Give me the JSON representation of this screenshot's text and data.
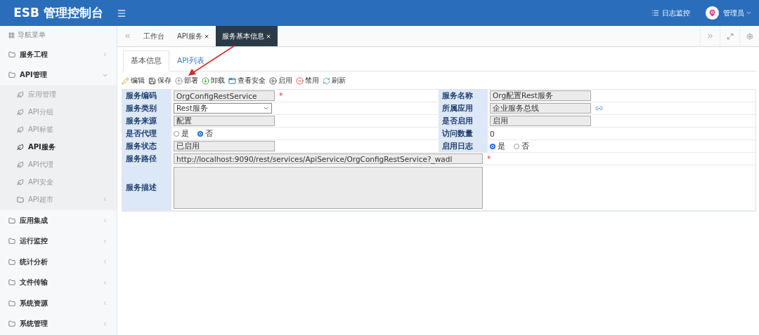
{
  "header": {
    "title": "ESB 管理控制台",
    "log_link": "日志监控",
    "user": "管理员"
  },
  "sidebar": {
    "title": "导航菜单",
    "items": [
      {
        "label": "服务工程",
        "kind": "folder",
        "expanded": false,
        "selected": false
      },
      {
        "label": "API管理",
        "kind": "folder",
        "expanded": true,
        "selected": false,
        "children": [
          {
            "label": "应用管理",
            "kind": "leaf",
            "selected": false
          },
          {
            "label": "API分组",
            "kind": "leaf",
            "selected": false
          },
          {
            "label": "API标签",
            "kind": "leaf",
            "selected": false
          },
          {
            "label": "API服务",
            "kind": "leaf",
            "selected": true
          },
          {
            "label": "API代理",
            "kind": "leaf",
            "selected": false
          },
          {
            "label": "API安全",
            "kind": "leaf",
            "selected": false
          },
          {
            "label": "API超市",
            "kind": "folder",
            "expanded": false,
            "selected": false
          }
        ]
      },
      {
        "label": "应用集成",
        "kind": "folder",
        "expanded": false,
        "selected": false
      },
      {
        "label": "运行监控",
        "kind": "folder",
        "expanded": false,
        "selected": false
      },
      {
        "label": "统计分析",
        "kind": "folder",
        "expanded": false,
        "selected": false
      },
      {
        "label": "文件传输",
        "kind": "folder",
        "expanded": false,
        "selected": false
      },
      {
        "label": "系统资源",
        "kind": "folder",
        "expanded": false,
        "selected": false
      },
      {
        "label": "系统管理",
        "kind": "folder",
        "expanded": false,
        "selected": false
      }
    ]
  },
  "tabs": [
    {
      "label": "工作台",
      "closable": false,
      "selected": false
    },
    {
      "label": "API服务",
      "closable": true,
      "selected": false
    },
    {
      "label": "服务基本信息",
      "closable": true,
      "selected": true
    }
  ],
  "subtabs": [
    {
      "label": "基本信息",
      "selected": true
    },
    {
      "label": "API列表",
      "selected": false
    }
  ],
  "toolbar": [
    "编辑",
    "保存",
    "部署",
    "卸载",
    "查看安全",
    "启用",
    "禁用",
    "刷新"
  ],
  "form": {
    "rows": [
      {
        "fields": [
          {
            "label": "服务编码",
            "kind": "input",
            "value": "OrgConfigRestService",
            "required_mark": "*"
          },
          {
            "label": "服务名称",
            "kind": "input",
            "value": "Org配置Rest服务"
          }
        ]
      },
      {
        "fields": [
          {
            "label": "服务类别",
            "kind": "select",
            "value": "Rest服务"
          },
          {
            "label": "所属应用",
            "kind": "lookup",
            "value": "企业服务总线"
          }
        ]
      },
      {
        "fields": [
          {
            "label": "服务来源",
            "kind": "input",
            "value": "配置"
          },
          {
            "label": "是否启用",
            "kind": "input",
            "value": "启用"
          }
        ]
      },
      {
        "fields": [
          {
            "label": "是否代理",
            "kind": "radio",
            "options": [
              {
                "label": "是",
                "selected": false
              },
              {
                "label": "否",
                "selected": true
              }
            ]
          },
          {
            "label": "访问数量",
            "kind": "text",
            "value": "0"
          }
        ]
      },
      {
        "fields": [
          {
            "label": "服务状态",
            "kind": "input",
            "value": "已启用"
          },
          {
            "label": "启用日志",
            "kind": "radio",
            "options": [
              {
                "label": "是",
                "selected": true
              },
              {
                "label": "否",
                "selected": false
              }
            ]
          }
        ]
      },
      {
        "fields": [
          {
            "label": "服务路径",
            "kind": "input",
            "value": "http://localhost:9090/rest/services/ApiService/OrgConfigRestService?_wadl",
            "required_mark": "*"
          }
        ]
      },
      {
        "fields": [
          {
            "label": "服务描述",
            "kind": "textarea"
          }
        ]
      }
    ]
  }
}
